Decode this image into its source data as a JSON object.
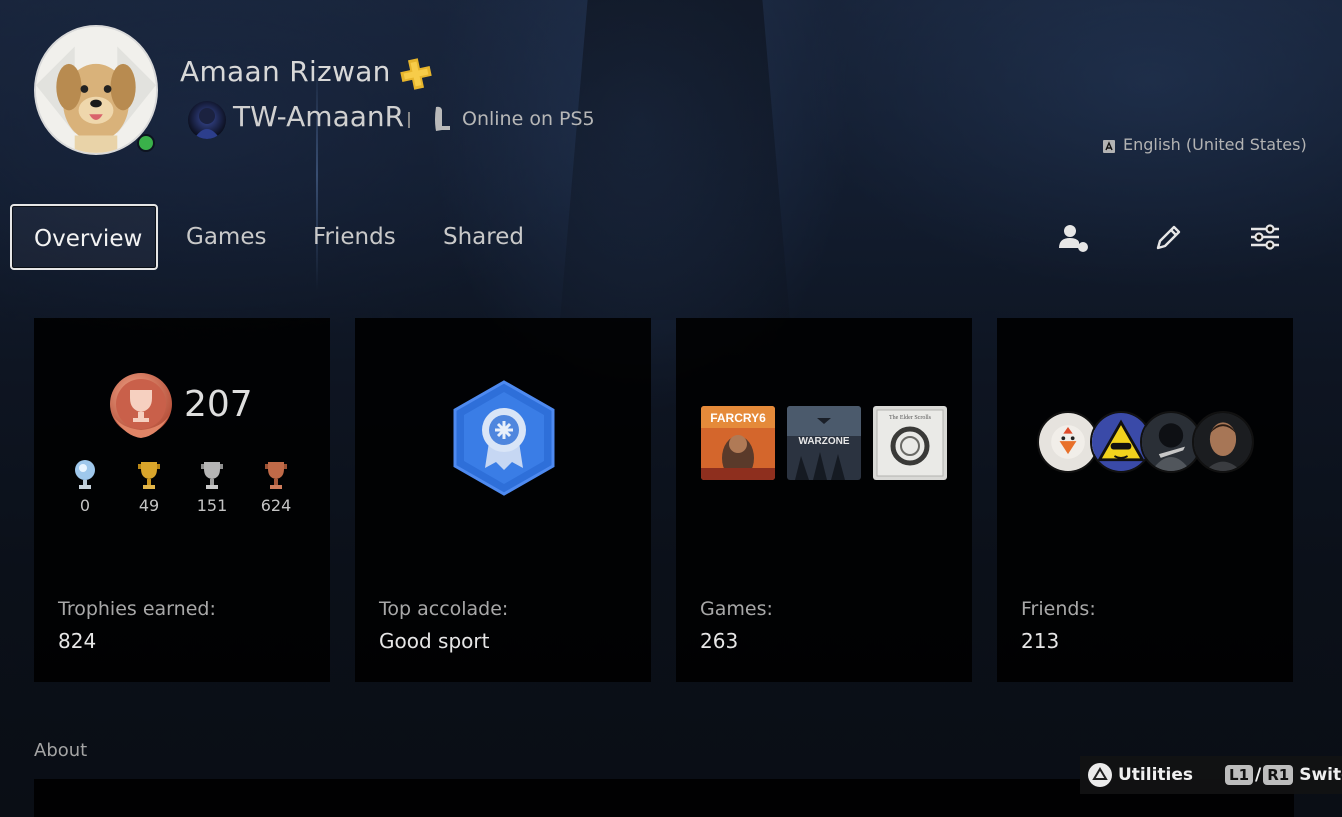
{
  "profile": {
    "real_name": "Amaan Rizwan",
    "online_id": "TW-AmaanR",
    "status": "Online on PS5",
    "language": "English (United States)"
  },
  "tabs": [
    {
      "label": "Overview",
      "active": true
    },
    {
      "label": "Games",
      "active": false
    },
    {
      "label": "Friends",
      "active": false
    },
    {
      "label": "Shared",
      "active": false
    }
  ],
  "toolbar": {
    "icons": [
      "add-friend-icon",
      "edit-icon",
      "settings-sliders-icon"
    ]
  },
  "cards": {
    "trophies": {
      "level": "207",
      "counts": {
        "platinum": "0",
        "gold": "49",
        "silver": "151",
        "bronze": "624"
      },
      "label": "Trophies earned:",
      "value": "824"
    },
    "accolade": {
      "label": "Top accolade:",
      "value": "Good sport"
    },
    "games": {
      "label": "Games:",
      "value": "263",
      "thumbs": [
        {
          "title": "FARCRY6"
        },
        {
          "title": "WARZONE"
        },
        {
          "title": "The Elder Scrolls"
        }
      ]
    },
    "friends": {
      "label": "Friends:",
      "value": "213"
    }
  },
  "about": {
    "label": "About"
  },
  "hints": {
    "utilities": "Utilities",
    "key_l1": "L1",
    "slash": "/",
    "key_r1": "R1",
    "switch": "Switch"
  },
  "colors": {
    "accent_gold": "#e7b52c",
    "online_green": "#3ab14a",
    "accolade_blue": "#2e6fd9"
  }
}
